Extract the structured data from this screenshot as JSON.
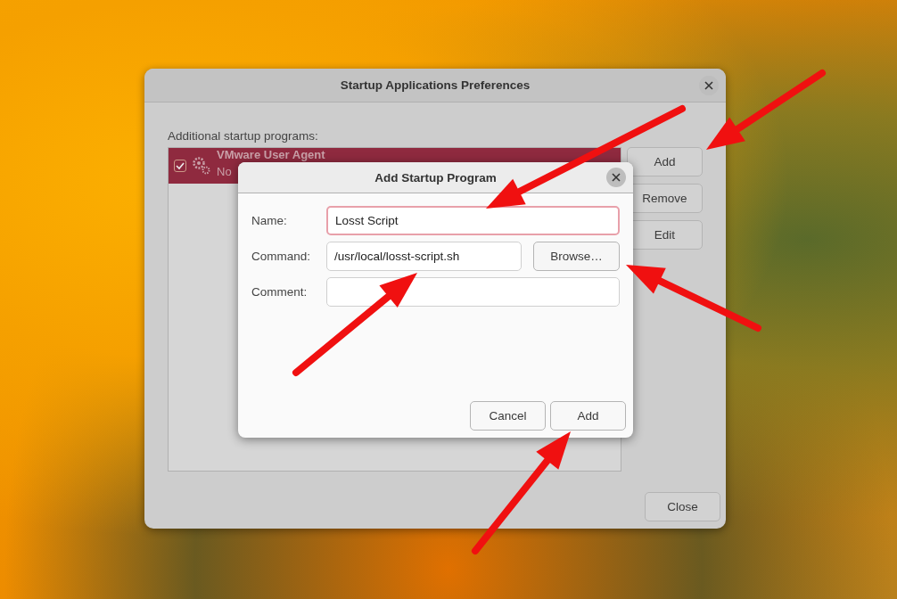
{
  "main_window": {
    "title": "Startup Applications Preferences",
    "list_label": "Additional startup programs:",
    "programs": [
      {
        "name": "VMware User Agent",
        "description": "No",
        "checked": true,
        "selected": true
      }
    ],
    "side_buttons": [
      "Add",
      "Remove",
      "Edit"
    ],
    "close_button": "Close"
  },
  "dialog": {
    "title": "Add Startup Program",
    "fields": [
      {
        "label": "Name:",
        "value": "Losst Script",
        "focused": true
      },
      {
        "label": "Command:",
        "value": "/usr/local/losst-script.sh",
        "focused": false,
        "button": "Browse…"
      },
      {
        "label": "Comment:",
        "focused": false
      }
    ],
    "buttons": [
      "Cancel",
      "Add"
    ]
  }
}
